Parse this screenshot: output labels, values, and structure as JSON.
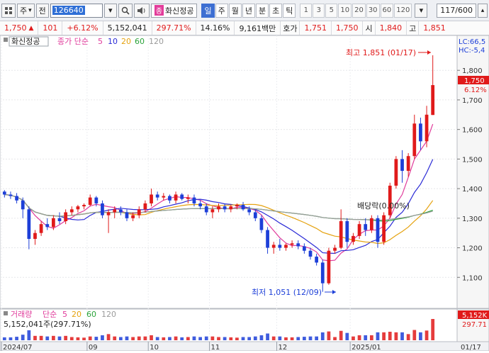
{
  "toolbar": {
    "menu_icon": "grid-icon",
    "market": "주",
    "market_dropdown": "▾",
    "whole_label": "전",
    "code": "126640",
    "search_icon": "search-icon",
    "sound_icon": "speaker-icon",
    "badge": "종",
    "name": "화신정공",
    "periods": [
      "일",
      "주",
      "월",
      "년",
      "분",
      "초",
      "틱"
    ],
    "active_period": "일",
    "intervals": [
      "1",
      "3",
      "5",
      "10",
      "20",
      "30",
      "60",
      "120"
    ],
    "count": "117/600"
  },
  "quote": {
    "price": "1,750",
    "change": "101",
    "change_pct": "+6.12%",
    "volume": "5,152,041",
    "volume_ratio": "297.71%",
    "turnover": "14.16%",
    "amount": "9,161백만",
    "bid_label": "호가",
    "bid1": "1,751",
    "bid2": "1,750",
    "open_label": "시",
    "open": "1,840",
    "high_label": "고",
    "high": "1,851"
  },
  "chart": {
    "title_name": "화신정공",
    "ma_label": "종가 단순",
    "ma_periods": [
      "5",
      "10",
      "20",
      "60",
      "120"
    ],
    "ma_colors": [
      "#e03b9b",
      "#2b2bd6",
      "#e5a20f",
      "#2aa33a",
      "#9b9b9b"
    ],
    "high_annot": "최고 1,851 (01/17)",
    "low_annot": "최저 1,051 (12/09)",
    "dividend_annot": "배당락(0.00%)",
    "lc_label": "LC:66,5",
    "hc_label": "HC:-5,4",
    "current_price_tag": "1,750",
    "current_pct_tag": "6.12%",
    "y_ticks": [
      "1,800",
      "1,700",
      "1,600",
      "1,500",
      "1,400",
      "1,300",
      "1,200",
      "1,100"
    ],
    "x_ticks": [
      "2024/07",
      "09",
      "10",
      "11",
      "12",
      "2025/01",
      "01/17"
    ],
    "volume_title": "거래량",
    "volume_ma_label": "단순",
    "volume_ma_periods": [
      "5",
      "20",
      "60",
      "120"
    ],
    "volume_value": "5,152,041주(297.71%)",
    "volume_tag": "5,152K",
    "volume_pct_tag": "297.71"
  },
  "chart_data": {
    "type": "candlestick",
    "title": "화신정공",
    "ylim": [
      1000,
      1870
    ],
    "highest": {
      "value": 1851,
      "date": "01/17"
    },
    "lowest": {
      "value": 1051,
      "date": "12/09"
    },
    "last_close": 1750,
    "candles": [
      [
        1390,
        1395,
        1370,
        1380
      ],
      [
        1380,
        1390,
        1365,
        1375
      ],
      [
        1375,
        1385,
        1350,
        1360
      ],
      [
        1360,
        1370,
        1300,
        1330
      ],
      [
        1330,
        1340,
        1195,
        1230
      ],
      [
        1230,
        1260,
        1210,
        1250
      ],
      [
        1250,
        1290,
        1240,
        1280
      ],
      [
        1280,
        1300,
        1260,
        1270
      ],
      [
        1270,
        1310,
        1260,
        1300
      ],
      [
        1300,
        1320,
        1280,
        1290
      ],
      [
        1290,
        1330,
        1280,
        1320
      ],
      [
        1320,
        1340,
        1310,
        1330
      ],
      [
        1330,
        1345,
        1320,
        1340
      ],
      [
        1340,
        1350,
        1330,
        1345
      ],
      [
        1345,
        1380,
        1340,
        1370
      ],
      [
        1370,
        1375,
        1340,
        1350
      ],
      [
        1350,
        1360,
        1300,
        1310
      ],
      [
        1310,
        1330,
        1250,
        1320
      ],
      [
        1320,
        1340,
        1300,
        1330
      ],
      [
        1330,
        1340,
        1310,
        1320
      ],
      [
        1320,
        1330,
        1290,
        1300
      ],
      [
        1300,
        1320,
        1290,
        1310
      ],
      [
        1310,
        1340,
        1300,
        1330
      ],
      [
        1330,
        1360,
        1320,
        1350
      ],
      [
        1350,
        1400,
        1340,
        1380
      ],
      [
        1380,
        1390,
        1360,
        1370
      ],
      [
        1370,
        1385,
        1360,
        1375
      ],
      [
        1375,
        1380,
        1350,
        1360
      ],
      [
        1360,
        1390,
        1350,
        1380
      ],
      [
        1380,
        1385,
        1360,
        1365
      ],
      [
        1365,
        1380,
        1350,
        1370
      ],
      [
        1370,
        1380,
        1340,
        1350
      ],
      [
        1350,
        1360,
        1330,
        1340
      ],
      [
        1340,
        1350,
        1310,
        1320
      ],
      [
        1320,
        1340,
        1300,
        1330
      ],
      [
        1330,
        1350,
        1320,
        1340
      ],
      [
        1340,
        1350,
        1320,
        1330
      ],
      [
        1330,
        1345,
        1320,
        1340
      ],
      [
        1340,
        1350,
        1330,
        1345
      ],
      [
        1345,
        1355,
        1325,
        1330
      ],
      [
        1330,
        1340,
        1310,
        1320
      ],
      [
        1320,
        1330,
        1290,
        1300
      ],
      [
        1300,
        1310,
        1250,
        1260
      ],
      [
        1260,
        1270,
        1180,
        1200
      ],
      [
        1200,
        1220,
        1180,
        1210
      ],
      [
        1210,
        1230,
        1190,
        1200
      ],
      [
        1200,
        1215,
        1190,
        1210
      ],
      [
        1210,
        1225,
        1200,
        1215
      ],
      [
        1215,
        1225,
        1195,
        1205
      ],
      [
        1205,
        1215,
        1180,
        1190
      ],
      [
        1190,
        1200,
        1160,
        1170
      ],
      [
        1170,
        1180,
        1140,
        1150
      ],
      [
        1150,
        1160,
        1051,
        1080
      ],
      [
        1080,
        1200,
        1075,
        1190
      ],
      [
        1190,
        1210,
        1180,
        1200
      ],
      [
        1200,
        1330,
        1195,
        1290
      ],
      [
        1290,
        1300,
        1200,
        1220
      ],
      [
        1220,
        1250,
        1210,
        1240
      ],
      [
        1240,
        1290,
        1230,
        1280
      ],
      [
        1280,
        1300,
        1240,
        1260
      ],
      [
        1260,
        1310,
        1250,
        1300
      ],
      [
        1300,
        1310,
        1200,
        1220
      ],
      [
        1220,
        1320,
        1210,
        1310
      ],
      [
        1310,
        1420,
        1300,
        1410
      ],
      [
        1410,
        1510,
        1400,
        1500
      ],
      [
        1500,
        1530,
        1420,
        1460
      ],
      [
        1460,
        1520,
        1440,
        1510
      ],
      [
        1510,
        1650,
        1500,
        1620
      ],
      [
        1620,
        1640,
        1530,
        1560
      ],
      [
        1560,
        1680,
        1540,
        1650
      ],
      [
        1649,
        1851,
        1649,
        1750
      ]
    ]
  }
}
